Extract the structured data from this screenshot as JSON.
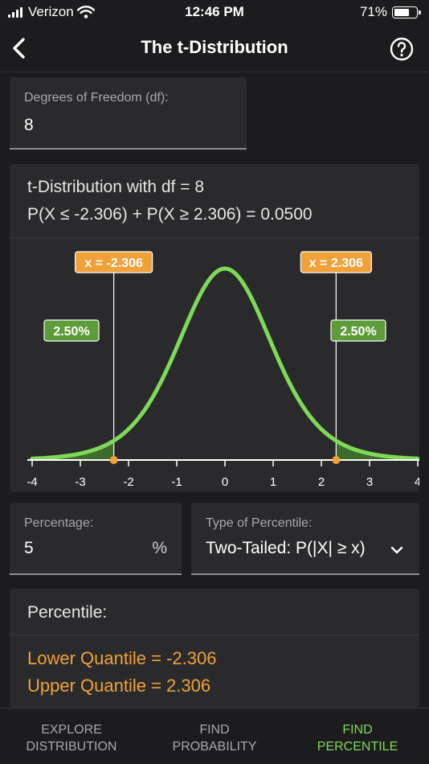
{
  "status_bar": {
    "carrier": "Verizon",
    "time": "12:46 PM",
    "battery": "71%",
    "battery_level": 0.71
  },
  "nav": {
    "title": "The t-Distribution",
    "back_icon": "chevron-left-icon",
    "help_icon": "question-circle-icon"
  },
  "df_field": {
    "label": "Degrees of Freedom (df):",
    "value": "8"
  },
  "chart": {
    "line1": "t-Distribution with df = 8",
    "line2": "P(X ≤ -2.306) + P(X ≥ 2.306) = 0.0500"
  },
  "chart_data": {
    "type": "area",
    "title": "t-Distribution with df = 8",
    "df": 8,
    "xlim": [
      -4,
      4
    ],
    "x_ticks": [
      "-4",
      "-3",
      "-2",
      "-1",
      "0",
      "1",
      "2",
      "3",
      "4"
    ],
    "lower_cutoff": -2.306,
    "upper_cutoff": 2.306,
    "lower_cutoff_label": "x = -2.306",
    "upper_cutoff_label": "x = 2.306",
    "lower_tail_label": "2.50%",
    "upper_tail_label": "2.50%",
    "curve_color": "#7ed957",
    "tail_fill_color": "#3d6b2a",
    "marker_color": "#f0a13a"
  },
  "percentage_field": {
    "label": "Percentage:",
    "value": "5",
    "suffix": "%"
  },
  "percentile_type_field": {
    "label": "Type of Percentile:",
    "value": "Two-Tailed: P(|X| ≥ x)",
    "icon": "chevron-down-icon"
  },
  "percentile": {
    "title": "Percentile:",
    "lower": "Lower Quantile = -2.306",
    "upper": "Upper Quantile = 2.306"
  },
  "tabs": [
    {
      "line1": "EXPLORE",
      "line2": "DISTRIBUTION",
      "active": false
    },
    {
      "line1": "FIND",
      "line2": "PROBABILITY",
      "active": false
    },
    {
      "line1": "FIND",
      "line2": "PERCENTILE",
      "active": true
    }
  ],
  "colors": {
    "accent_green": "#7ed957",
    "accent_orange": "#f0a13a",
    "background": "#1c1c1e",
    "card": "#2a2a2c"
  }
}
